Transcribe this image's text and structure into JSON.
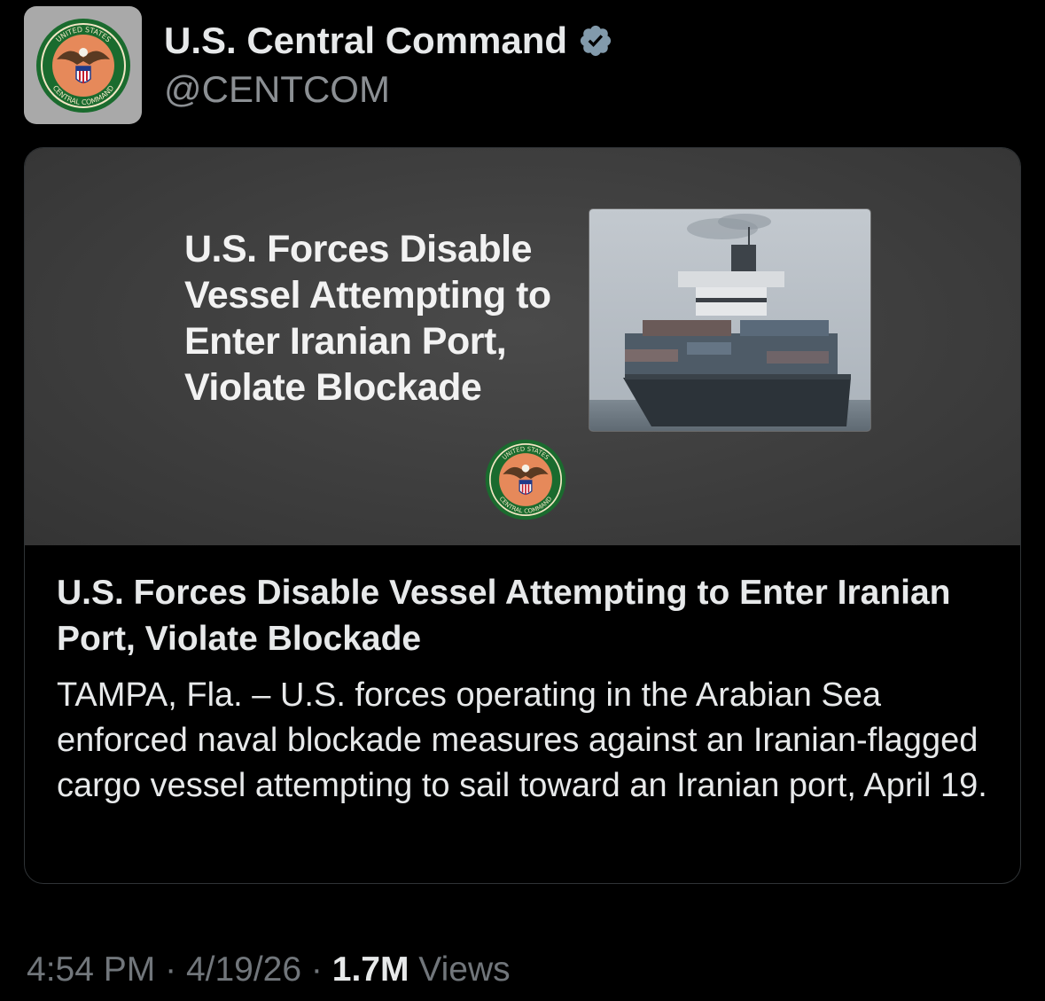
{
  "author": {
    "name": "U.S. Central Command",
    "handle": "@CENTCOM",
    "verified": true,
    "avatar_icon": "centcom-seal-icon",
    "seal_text_top": "UNITED STATES",
    "seal_text_bottom": "CENTRAL COMMAND"
  },
  "card": {
    "media_headline": "U.S. Forces Disable\nVessel Attempting to\nEnter Iranian Port,\nViolate Blockade",
    "media_photo_icon": "cargo-ship-photo",
    "media_seal_icon": "centcom-seal-icon",
    "title": "U.S. Forces Disable Vessel Attempting to Enter Iranian Port, Violate Blockade",
    "description": "TAMPA, Fla. – U.S. forces operating in the Arabian Sea enforced naval blockade measures against an Iranian-flagged cargo vessel attempting to sail toward an Iranian port, April 19."
  },
  "meta": {
    "time": "4:54 PM",
    "separator": "·",
    "date": "4/19/26",
    "views_count": "1.7M",
    "views_label": "Views"
  },
  "colors": {
    "background": "#000000",
    "text_primary": "#e7e9ea",
    "text_secondary": "#71767b",
    "verified_badge": "#829aab",
    "card_border": "#2f3336"
  }
}
